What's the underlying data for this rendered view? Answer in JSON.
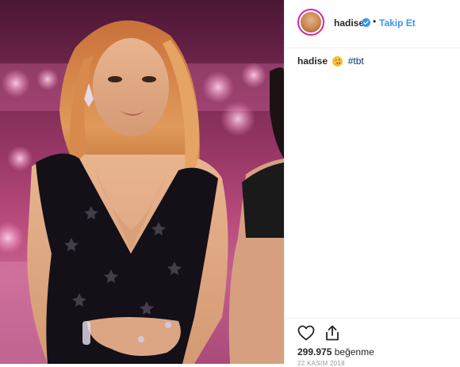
{
  "post": {
    "username": "hadise",
    "follow_label": "Takip Et",
    "separator": "•",
    "caption_user": "hadise",
    "caption_hashtag": "#tbt",
    "likes_count": "299.975",
    "likes_label": "beğenme",
    "date": "22 KASIM 2018"
  },
  "icons": {
    "verified": "verified-badge-icon",
    "emoji": "kissing-face-emoji-icon",
    "like": "heart-outline-icon",
    "share": "share-upload-icon"
  },
  "colors": {
    "link": "#3897f0",
    "text": "#262626",
    "border": "#efefef",
    "hashtag": "#003569"
  }
}
